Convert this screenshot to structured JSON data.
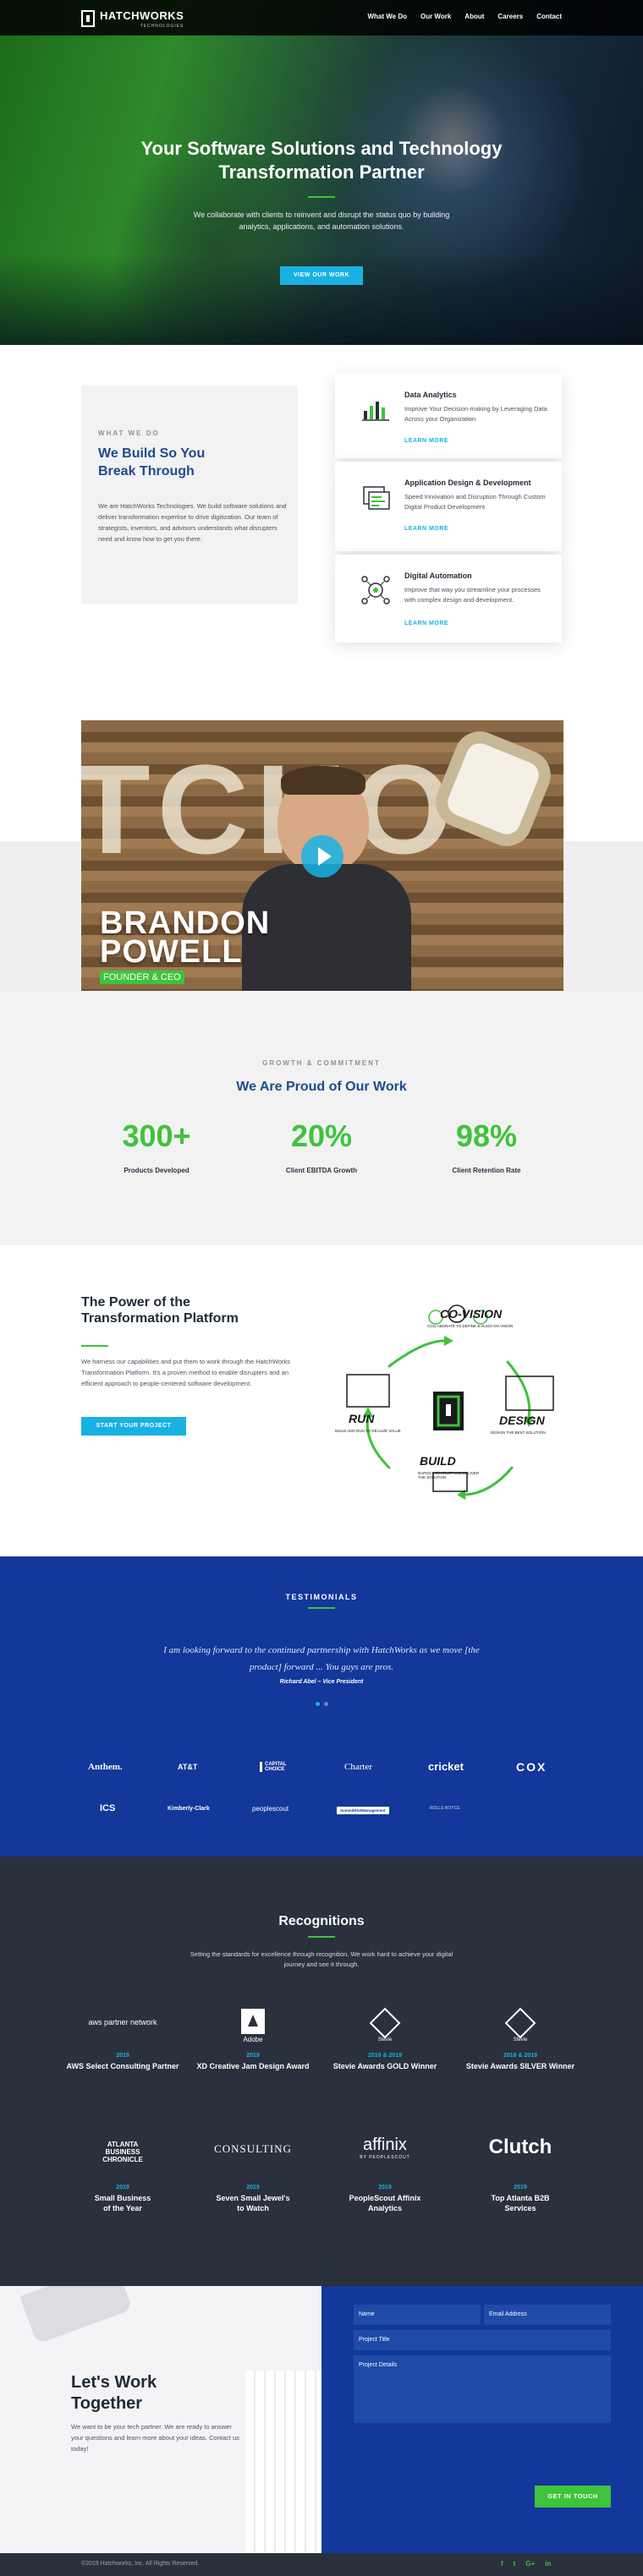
{
  "nav": {
    "brand": "HATCHWORKS",
    "brand_sub": "TECHNOLOGIES",
    "links": [
      "What We Do",
      "Our Work",
      "About",
      "Careers",
      "Contact"
    ]
  },
  "hero": {
    "title_line1": "Your Software Solutions and Technology",
    "title_line2": "Transformation Partner",
    "subtitle": "We collaborate with clients to reinvent and disrupt the status quo by building analytics, applications, and automation solutions.",
    "cta": "VIEW OUR WORK"
  },
  "what_we_do": {
    "eyebrow": "WHAT WE DO",
    "heading_line1": "We Build So You",
    "heading_line2": "Break Through",
    "body": "We are HatchWorks Technologies. We build software solutions and deliver transformation expertise to drive digitization. Our team of strategists, inventors, and advisors understands what disrupters need and know how to get you there.",
    "cards": [
      {
        "title": "Data Analytics",
        "desc": "Improve Your Decision-making by Leveraging Data Across your Organization",
        "link": "LEARN MORE",
        "icon": "analytics-icon"
      },
      {
        "title": "Application Design & Development",
        "desc": "Speed Innovation and Disruption Through Custom Digital Product Development",
        "link": "LEARN MORE",
        "icon": "app-development-icon"
      },
      {
        "title": "Digital Automation",
        "desc": "Improve that way you streamline your processes with complex design and development.",
        "link": "LEARN MORE",
        "icon": "automation-icon"
      }
    ]
  },
  "video": {
    "name_line1": "BRANDON",
    "name_line2": "POWELL",
    "role": "FOUNDER & CEO",
    "wall_letters": "TCHO"
  },
  "stats": {
    "eyebrow": "GROWTH & COMMITMENT",
    "heading": "We Are Proud of Our Work",
    "items": [
      {
        "value": "300+",
        "label": "Products Developed"
      },
      {
        "value": "20%",
        "label": "Client EBITDA Growth"
      },
      {
        "value": "98%",
        "label": "Client Retention Rate"
      }
    ]
  },
  "platform": {
    "heading_line1": "The Power of the",
    "heading_line2": "Transformation Platform",
    "body": "We harness our capabilities and put them to work through the HatchWorks Transformation Platform. It's a proven method to enable disrupters and an efficient approach to people-centered software development.",
    "cta": "START YOUR PROJECT",
    "diagram": {
      "covision": "CO-VISION",
      "covision_sub": "COLLABORATE TO DEFINE & ALIGN ON VISION",
      "run": "RUN",
      "run_sub": "BUILD AND RUN TO REALIZE VALUE",
      "design": "DESIGN",
      "design_sub": "DESIGN THE BEST SOLUTION",
      "build": "BUILD",
      "build_sub": "RAPIDLY DEVELOP AND DELIVER THE SOLUTION"
    }
  },
  "testimonials": {
    "heading": "TESTIMONIALS",
    "quote_line1": "I am looking forward to the continued partnership with HatchWorks as we move [the",
    "quote_line2": "product] forward ... You guys are pros.",
    "author": "Richard Abel – Vice President",
    "clients_row1": [
      "Anthem.",
      "AT&T",
      "CAPITAL CHOICE",
      "Charter",
      "cricket",
      "COX"
    ],
    "clients_row2": [
      "ICS",
      "Kimberly-Clark",
      "peoplescout",
      "SummitRiskManagement",
      "ROLLS ROYCE"
    ]
  },
  "recognitions": {
    "heading": "Recognitions",
    "intro": "Setting the standards for excellence through recognition. We work hard to achieve your digital journey and see it through.",
    "awards": [
      {
        "logo": "aws partner network",
        "year": "2019",
        "name": "AWS Select Consulting Partner"
      },
      {
        "logo": "Adobe",
        "year": "2019",
        "name": "XD Creative Jam Design Award"
      },
      {
        "logo": "Stevie",
        "year": "2018 & 2019",
        "name": "Stevie Awards GOLD Winner"
      },
      {
        "logo": "Stevie",
        "year": "2018 & 2019",
        "name": "Stevie Awards SILVER Winner"
      },
      {
        "logo": "ATLANTA BUSINESS CHRONICLE",
        "year": "2019",
        "name": "Small Business of the Year"
      },
      {
        "logo": "CONSULTING",
        "year": "2019",
        "name": "Seven Small Jewel's to Watch"
      },
      {
        "logo": "affinix",
        "logo_sub": "BY PEOPLESCOUT",
        "year": "2019",
        "name": "PeopleScout Affinix Analytics"
      },
      {
        "logo": "Clutch",
        "year": "2019",
        "name": "Top Atlanta B2B Services"
      }
    ]
  },
  "contact": {
    "heading_line1": "Let's Work",
    "heading_line2": "Together",
    "body": "We want to be your tech partner. We are ready to answer your questions and learn more about your ideas. Contact us today!",
    "name_ph": "Name",
    "email_ph": "Email Address",
    "title_ph": "Project Title",
    "details_ph": "Project Details",
    "submit": "GET IN TOUCH"
  },
  "footer": {
    "copyright": "©2019 Hatchworks, Inc. All Rights Reserved.",
    "social": [
      "f",
      "t",
      "G+",
      "in"
    ]
  },
  "colors": {
    "green": "#3ec33a",
    "cyan": "#19b1e4",
    "navy": "#13379a",
    "dark": "#2a303c",
    "heading_blue": "#1f4a8e"
  }
}
